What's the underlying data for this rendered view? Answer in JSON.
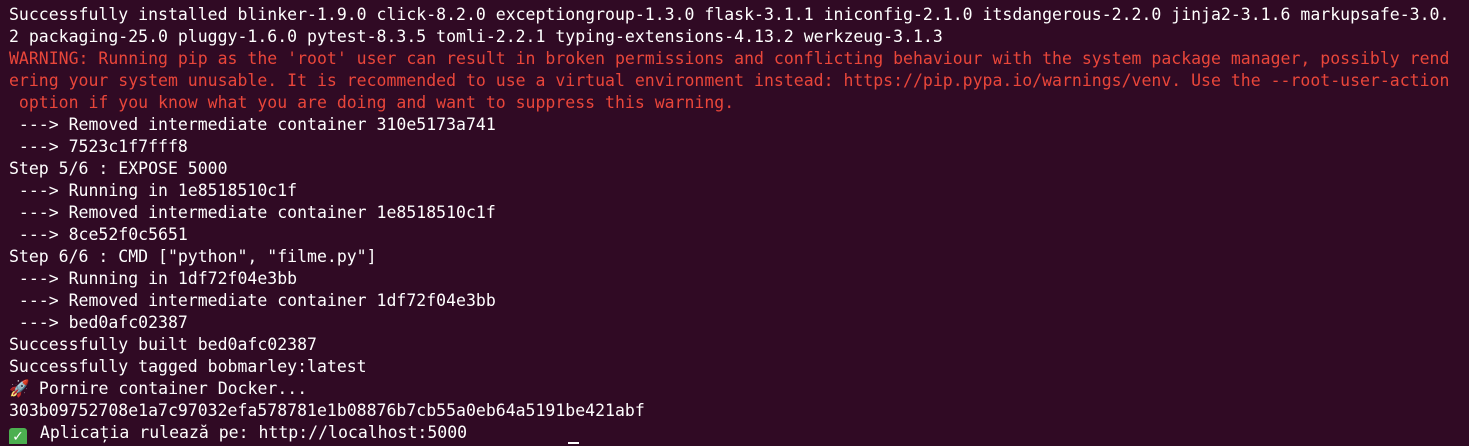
{
  "terminal": {
    "background": "#300a24",
    "text_color": "#ffffff",
    "warning_color": "#e9463a",
    "lines": [
      {
        "text": "Successfully installed blinker-1.9.0 click-8.2.0 exceptiongroup-1.3.0 flask-3.1.1 iniconfig-2.1.0 itsdangerous-2.2.0 jinja2-3.1.6 markupsafe-3.0.",
        "style": "normal"
      },
      {
        "text": "2 packaging-25.0 pluggy-1.6.0 pytest-8.3.5 tomli-2.2.1 typing-extensions-4.13.2 werkzeug-3.1.3",
        "style": "normal"
      },
      {
        "text": "WARNING: Running pip as the 'root' user can result in broken permissions and conflicting behaviour with the system package manager, possibly rend",
        "style": "warning"
      },
      {
        "text": "ering your system unusable. It is recommended to use a virtual environment instead: https://pip.pypa.io/warnings/venv. Use the --root-user-action",
        "style": "warning"
      },
      {
        "text": " option if you know what you are doing and want to suppress this warning.",
        "style": "warning"
      },
      {
        "text": " ---> Removed intermediate container 310e5173a741",
        "style": "normal"
      },
      {
        "text": " ---> 7523c1f7fff8",
        "style": "normal"
      },
      {
        "text": "Step 5/6 : EXPOSE 5000",
        "style": "normal"
      },
      {
        "text": " ---> Running in 1e8518510c1f",
        "style": "normal"
      },
      {
        "text": " ---> Removed intermediate container 1e8518510c1f",
        "style": "normal"
      },
      {
        "text": " ---> 8ce52f0c5651",
        "style": "normal"
      },
      {
        "text": "Step 6/6 : CMD [\"python\", \"filme.py\"]",
        "style": "normal"
      },
      {
        "text": " ---> Running in 1df72f04e3bb",
        "style": "normal"
      },
      {
        "text": " ---> Removed intermediate container 1df72f04e3bb",
        "style": "normal"
      },
      {
        "text": " ---> bed0afc02387",
        "style": "normal"
      },
      {
        "text": "Successfully built bed0afc02387",
        "style": "normal"
      },
      {
        "text": "Successfully tagged bobmarley:latest",
        "style": "normal"
      },
      {
        "text": " Pornire container Docker...",
        "style": "normal",
        "icon": "rocket-icon",
        "glyph": "🚀"
      },
      {
        "text": "303b09752708e1a7c97032efa578781e1b08876b7cb55a0eb64a5191be421abf",
        "style": "normal"
      },
      {
        "text": " Aplicația rulează pe: http://localhost:5000",
        "style": "normal",
        "icon": "check-icon",
        "glyph": "✓"
      }
    ]
  }
}
